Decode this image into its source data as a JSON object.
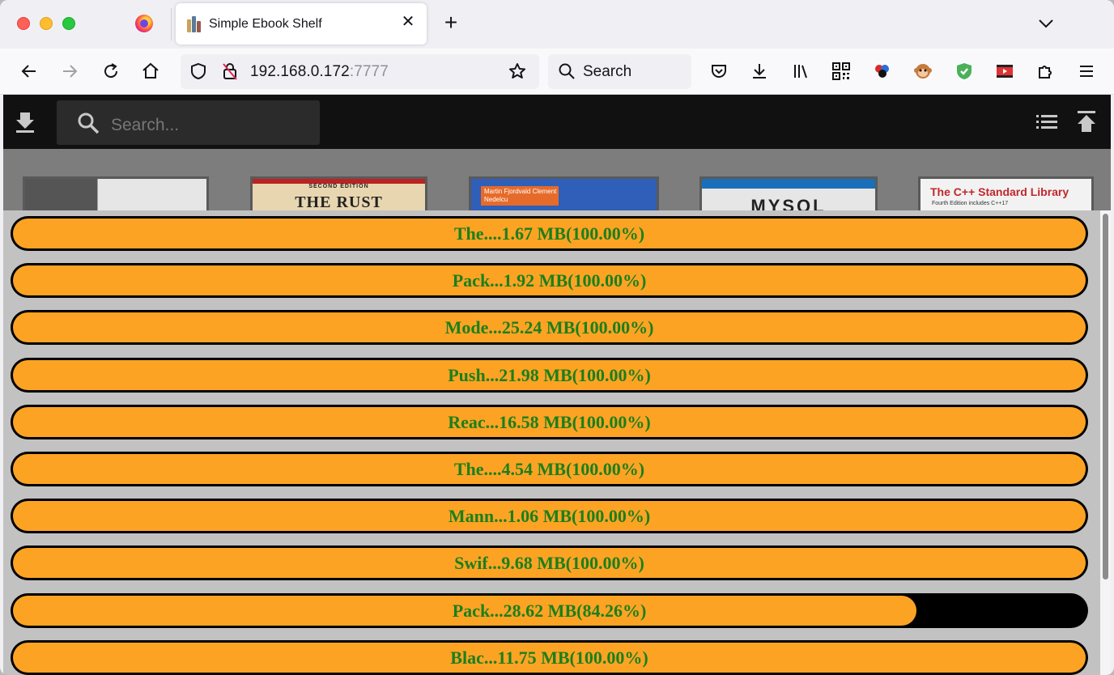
{
  "browser": {
    "tab_title": "Simple Ebook Shelf",
    "url_host": "192.168.0.172",
    "url_port": ":7777",
    "search_placeholder": "Search"
  },
  "app": {
    "search_placeholder": "Search...",
    "accent_color": "#fca324",
    "label_color": "#1b7f1b"
  },
  "books": [
    {
      "cover_text": ""
    },
    {
      "cover_edition": "SECOND EDITION",
      "cover_text": "THE RUST"
    },
    {
      "cover_text": "Martin Fjordvald  Clement Nedelcu"
    },
    {
      "cover_text": "MYSQL"
    },
    {
      "cover_text": "The C++ Standard Library",
      "cover_sub": "Fourth Edition includes C++17"
    }
  ],
  "progress": [
    {
      "label": "The....1.67 MB(100.00%)",
      "percent": 100.0
    },
    {
      "label": "Pack...1.92 MB(100.00%)",
      "percent": 100.0
    },
    {
      "label": "Mode...25.24 MB(100.00%)",
      "percent": 100.0
    },
    {
      "label": "Push...21.98 MB(100.00%)",
      "percent": 100.0
    },
    {
      "label": "Reac...16.58 MB(100.00%)",
      "percent": 100.0
    },
    {
      "label": "The....4.54 MB(100.00%)",
      "percent": 100.0
    },
    {
      "label": "Mann...1.06 MB(100.00%)",
      "percent": 100.0
    },
    {
      "label": "Swif...9.68 MB(100.00%)",
      "percent": 100.0
    },
    {
      "label": "Pack...28.62 MB(84.26%)",
      "percent": 84.26
    },
    {
      "label": "Blac...11.75 MB(100.00%)",
      "percent": 100.0
    }
  ]
}
